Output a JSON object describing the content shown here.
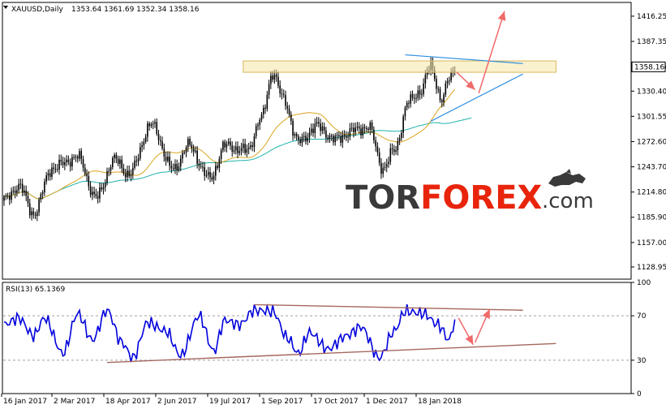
{
  "chart_data": [
    {
      "type": "candlestick",
      "title": "XAUUSD,Daily",
      "ohlc_label": "1353.64 1361.69 1352.34 1358.16",
      "last_price": "1358.16",
      "ylim": [
        1115,
        1432
      ],
      "y_ticks": [
        "1416.25",
        "1387.35",
        "1358.45",
        "1330.40",
        "1301.55",
        "1272.60",
        "1243.70",
        "1214.80",
        "1185.90",
        "1157.00",
        "1128.95"
      ],
      "x_ticks": [
        "16 Jan 2017",
        "2 Mar 2017",
        "18 Apr 2017",
        "2 Jun 2017",
        "19 Jul 2017",
        "1 Sep 2017",
        "17 Oct 2017",
        "1 Dec 2017",
        "18 Jan 2018"
      ],
      "trend_anchors": [
        {
          "t": 0,
          "p": 1205
        },
        {
          "t": 8,
          "p": 1222
        },
        {
          "t": 16,
          "p": 1190
        },
        {
          "t": 26,
          "p": 1242
        },
        {
          "t": 40,
          "p": 1255
        },
        {
          "t": 50,
          "p": 1208
        },
        {
          "t": 60,
          "p": 1252
        },
        {
          "t": 68,
          "p": 1235
        },
        {
          "t": 80,
          "p": 1292
        },
        {
          "t": 92,
          "p": 1240
        },
        {
          "t": 100,
          "p": 1268
        },
        {
          "t": 112,
          "p": 1230
        },
        {
          "t": 120,
          "p": 1268
        },
        {
          "t": 132,
          "p": 1262
        },
        {
          "t": 140,
          "p": 1300
        },
        {
          "t": 146,
          "p": 1352
        },
        {
          "t": 152,
          "p": 1320
        },
        {
          "t": 160,
          "p": 1272
        },
        {
          "t": 170,
          "p": 1290
        },
        {
          "t": 180,
          "p": 1275
        },
        {
          "t": 190,
          "p": 1285
        },
        {
          "t": 198,
          "p": 1290
        },
        {
          "t": 206,
          "p": 1242
        },
        {
          "t": 212,
          "p": 1262
        },
        {
          "t": 220,
          "p": 1318
        },
        {
          "t": 226,
          "p": 1330
        },
        {
          "t": 232,
          "p": 1358
        },
        {
          "t": 238,
          "p": 1320
        },
        {
          "t": 242,
          "p": 1345
        },
        {
          "t": 245,
          "p": 1358
        }
      ],
      "ma_fast_color": "#DAA520",
      "ma_slow_color": "#20B2AA",
      "resistance_zone": {
        "t_start": 130,
        "t_end": 300,
        "p_low": 1352,
        "p_high": 1365
      },
      "channel_upper": {
        "t1": 218,
        "p1": 1372,
        "t2": 282,
        "p2": 1362
      },
      "channel_lower": {
        "t1": 232,
        "p1": 1296,
        "t2": 282,
        "p2": 1350
      },
      "arrow_down": {
        "t1": 246,
        "p1": 1352,
        "t2": 256,
        "p2": 1332
      },
      "arrow_up": {
        "t1": 258,
        "p1": 1328,
        "t2": 272,
        "p2": 1422
      }
    },
    {
      "type": "line",
      "title": "RSI(13) 65.1369",
      "ylim": [
        0,
        100
      ],
      "y_ticks": [
        "100",
        "70",
        "30",
        "0"
      ],
      "rsi_anchors": [
        {
          "t": 0,
          "v": 62
        },
        {
          "t": 8,
          "v": 68
        },
        {
          "t": 16,
          "v": 52
        },
        {
          "t": 22,
          "v": 68
        },
        {
          "t": 32,
          "v": 36
        },
        {
          "t": 40,
          "v": 72
        },
        {
          "t": 48,
          "v": 48
        },
        {
          "t": 56,
          "v": 75
        },
        {
          "t": 64,
          "v": 46
        },
        {
          "t": 70,
          "v": 32
        },
        {
          "t": 78,
          "v": 64
        },
        {
          "t": 88,
          "v": 56
        },
        {
          "t": 96,
          "v": 34
        },
        {
          "t": 106,
          "v": 70
        },
        {
          "t": 114,
          "v": 38
        },
        {
          "t": 120,
          "v": 66
        },
        {
          "t": 128,
          "v": 62
        },
        {
          "t": 136,
          "v": 75
        },
        {
          "t": 146,
          "v": 74
        },
        {
          "t": 154,
          "v": 50
        },
        {
          "t": 160,
          "v": 36
        },
        {
          "t": 166,
          "v": 55
        },
        {
          "t": 176,
          "v": 40
        },
        {
          "t": 186,
          "v": 52
        },
        {
          "t": 194,
          "v": 60
        },
        {
          "t": 204,
          "v": 32
        },
        {
          "t": 212,
          "v": 56
        },
        {
          "t": 218,
          "v": 74
        },
        {
          "t": 228,
          "v": 72
        },
        {
          "t": 236,
          "v": 62
        },
        {
          "t": 242,
          "v": 48
        },
        {
          "t": 245,
          "v": 65
        }
      ],
      "line_color": "#0000DD",
      "trend_upper": {
        "t1": 136,
        "v1": 80,
        "t2": 282,
        "v2": 75
      },
      "trend_lower": {
        "t1": 56,
        "v1": 28,
        "t2": 300,
        "v2": 45
      },
      "arrow_down": {
        "t1": 247,
        "v1": 68,
        "t2": 255,
        "v2": 44
      },
      "arrow_up": {
        "t1": 256,
        "v1": 46,
        "t2": 264,
        "v2": 76
      }
    }
  ],
  "watermark": {
    "part1": "TOR",
    "part2": "FOREX",
    "part3": ".com",
    "color_dark": "#3A3A3A",
    "color_red": "#E8250C"
  }
}
